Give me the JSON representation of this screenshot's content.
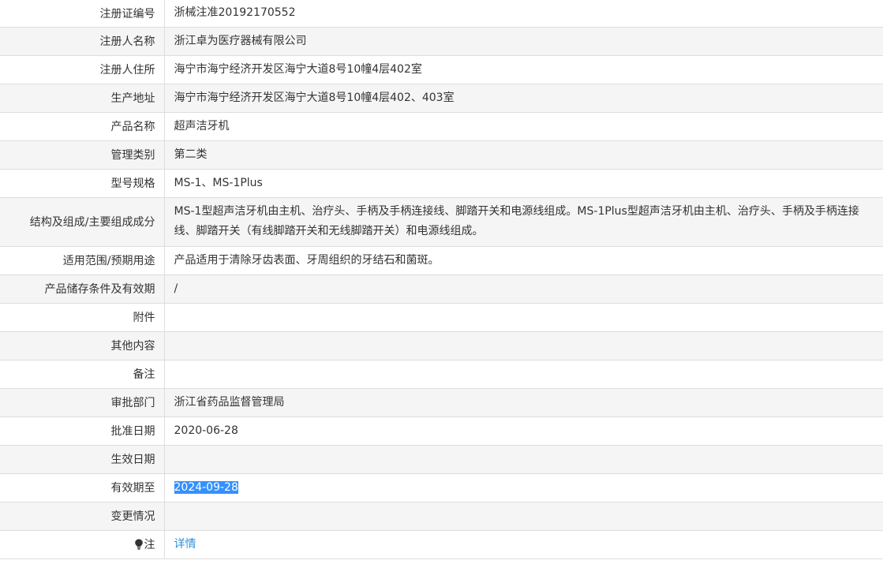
{
  "rows": [
    {
      "label": "注册证编号",
      "value": "浙械注准20192170552"
    },
    {
      "label": "注册人名称",
      "value": "浙江卓为医疗器械有限公司"
    },
    {
      "label": "注册人住所",
      "value": "海宁市海宁经济开发区海宁大道8号10幢4层402室"
    },
    {
      "label": "生产地址",
      "value": "海宁市海宁经济开发区海宁大道8号10幢4层402、403室"
    },
    {
      "label": "产品名称",
      "value": "超声洁牙机"
    },
    {
      "label": "管理类别",
      "value": "第二类"
    },
    {
      "label": "型号规格",
      "value": "MS-1、MS-1Plus"
    },
    {
      "label": "结构及组成/主要组成成分",
      "value": "MS-1型超声洁牙机由主机、治疗头、手柄及手柄连接线、脚踏开关和电源线组成。MS-1Plus型超声洁牙机由主机、治疗头、手柄及手柄连接线、脚踏开关（有线脚踏开关和无线脚踏开关）和电源线组成。"
    },
    {
      "label": "适用范围/预期用途",
      "value": "产品适用于清除牙齿表面、牙周组织的牙结石和菌斑。"
    },
    {
      "label": "产品储存条件及有效期",
      "value": "/"
    },
    {
      "label": "附件",
      "value": ""
    },
    {
      "label": "其他内容",
      "value": ""
    },
    {
      "label": "备注",
      "value": ""
    },
    {
      "label": "审批部门",
      "value": "浙江省药品监督管理局"
    },
    {
      "label": "批准日期",
      "value": "2020-06-28"
    },
    {
      "label": "生效日期",
      "value": ""
    },
    {
      "label": "有效期至",
      "value": "2024-09-28"
    },
    {
      "label": "变更情况",
      "value": ""
    },
    {
      "label": "注",
      "value": "详情",
      "icon": "lightbulb-icon"
    }
  ],
  "colors": {
    "stripe": "#f5f5f5",
    "border": "#dddddd",
    "text": "#333333",
    "link": "#2f8fd6",
    "selection": "#3390ff"
  }
}
